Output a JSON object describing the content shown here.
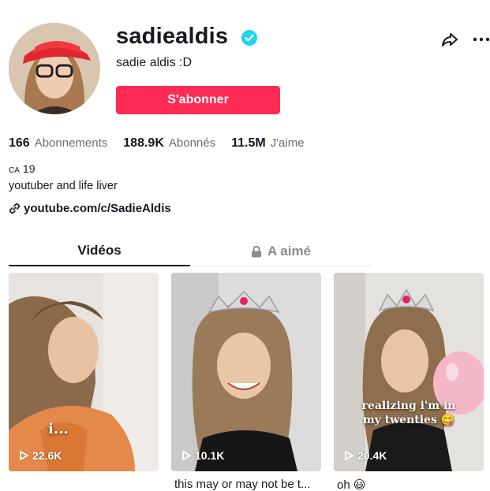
{
  "profile": {
    "username": "sadiealdis",
    "nickname": "sadie aldis :D",
    "follow_label": "S'abonner",
    "avatar_icon": "profile-avatar",
    "verified_icon": "verified-badge-icon"
  },
  "actions": {
    "share_icon": "share-arrow-icon",
    "more_icon": "more-dots-icon"
  },
  "stats": [
    {
      "value": "166",
      "label": "Abonnements"
    },
    {
      "value": "188.9K",
      "label": "Abonnés"
    },
    {
      "value": "11.5M",
      "label": "J'aime"
    }
  ],
  "bio": {
    "line1_prefix": "CA",
    "line1_value": "19",
    "line2": "youtuber and life liver",
    "link": "youtube.com/c/SadieAldis",
    "link_icon": "link-icon"
  },
  "tabs": [
    {
      "label": "Vidéos",
      "active": true
    },
    {
      "label": "A aimé",
      "active": false,
      "icon": "lock-icon"
    }
  ],
  "videos": [
    {
      "views": "22.6K",
      "overlay": "i...",
      "caption": ""
    },
    {
      "views": "10.1K",
      "overlay": "",
      "caption": "this may or may not be t..."
    },
    {
      "views": "20.4K",
      "overlay_line1": "realizing i'm in",
      "overlay_line2": "my twenties 😋",
      "caption": "oh 😃"
    }
  ],
  "colors": {
    "accent": "#fe2c55",
    "verified": "#20d5ec",
    "text": "#161823",
    "muted": "#6b6c72"
  }
}
